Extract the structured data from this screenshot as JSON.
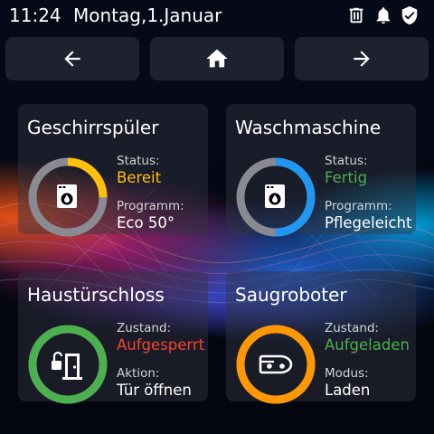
{
  "statusbar": {
    "time": "11:24",
    "date": "Montag,1.Januar",
    "icons": [
      "trash-icon",
      "bell-icon",
      "shield-check-icon"
    ]
  },
  "nav": {
    "back_icon": "arrow-left-icon",
    "home_icon": "home-icon",
    "forward_icon": "arrow-right-icon"
  },
  "colors": {
    "yellow": "#FFC107",
    "blue": "#2196F3",
    "green": "#4CAF50",
    "red": "#F44336",
    "orange": "#FF9800",
    "ring_track": "#8A8A92"
  },
  "cards": {
    "dishwasher": {
      "title": "Geschirrspüler",
      "icon": "washing-machine-icon",
      "ring_fraction": 0.25,
      "label1": "Status:",
      "value1": "Bereit",
      "label2": "Programm:",
      "value2": "Eco 50°"
    },
    "washer": {
      "title": "Waschmaschine",
      "icon": "washing-machine-icon",
      "ring_fraction": 0.5,
      "label1": "Status:",
      "value1": "Fertig",
      "label2": "Programm:",
      "value2": "Pflegeleicht"
    },
    "doorlock": {
      "title": "Haustürschloss",
      "icon": "door-lock-open-icon",
      "ring_fraction": 1.0,
      "label1": "Zustand:",
      "value1": "Aufgesperrt",
      "label2": "Aktion:",
      "value2": "Tür öffnen"
    },
    "vacuum": {
      "title": "Saugroboter",
      "icon": "robot-vacuum-icon",
      "ring_fraction": 1.0,
      "label1": "Zustand:",
      "value1": "Aufgeladen",
      "label2": "Modus:",
      "value2": "Laden"
    }
  }
}
